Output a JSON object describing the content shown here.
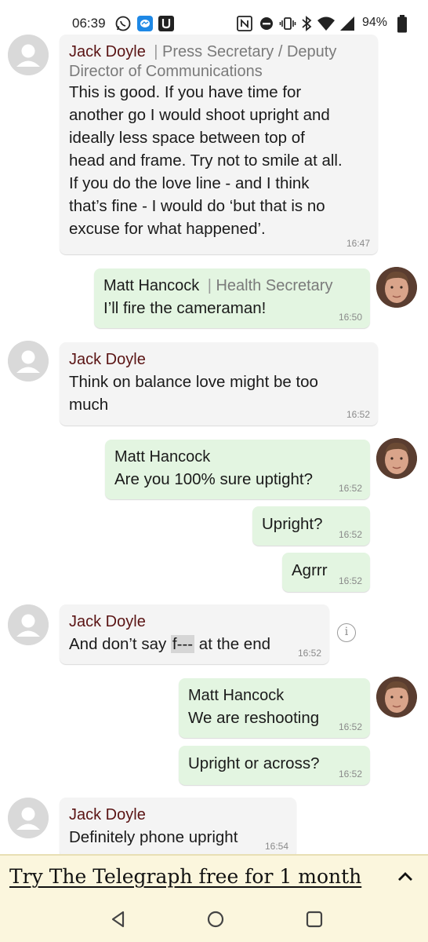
{
  "status_bar": {
    "time": "06:39",
    "battery": "94%",
    "icons": [
      "whatsapp-icon",
      "messenger-icon",
      "app-u-icon",
      "nfc-icon",
      "do-not-disturb-icon",
      "vibrate-icon",
      "bluetooth-icon",
      "wifi-icon",
      "signal-icon",
      "battery-icon"
    ]
  },
  "messages": [
    {
      "sender": "Jack Doyle",
      "role": "Press Secretary / Deputy Director of Communications",
      "role_sep": "|",
      "text_lines": [
        "This is good. If you have time for",
        "another go I would shoot upright and",
        "ideally less space between top of",
        "head and frame. Try not to smile at all.",
        "If you do the love line - and I think",
        "that’s fine - I would do ‘but that is no",
        "excuse for what happened’."
      ],
      "time": "16:47"
    },
    {
      "sender": "Matt Hancock",
      "role": "Health Secretary",
      "role_sep": "|",
      "text": "I’ll fire the cameraman!",
      "time": "16:50"
    },
    {
      "sender": "Jack Doyle",
      "text_lines": [
        "Think on balance love might be too",
        "much"
      ],
      "time": "16:52"
    },
    {
      "sender": "Matt Hancock",
      "text": "Are you 100% sure uptight?",
      "time": "16:52"
    },
    {
      "text": "Upright?",
      "time": "16:52"
    },
    {
      "text": "Agrrr",
      "time": "16:52"
    },
    {
      "sender": "Jack Doyle",
      "text_before": "And don’t say ",
      "text_redacted": "f---",
      "text_after": " at the end",
      "time": "16:52"
    },
    {
      "sender": "Matt Hancock",
      "text": "We are reshooting",
      "time": "16:52"
    },
    {
      "text": "Upright or across?",
      "time": "16:52"
    },
    {
      "sender": "Jack Doyle",
      "text": "Definitely phone upright",
      "time": "16:54"
    }
  ],
  "banner": {
    "text": "Try The Telegraph free for 1 month"
  },
  "colors": {
    "incoming_bubble": "#f4f4f4",
    "outgoing_bubble": "#e3f5e1",
    "jack_name": "#5a1414",
    "banner_bg": "#fbf6dd"
  },
  "nav": {
    "icons": [
      "back-icon",
      "home-icon",
      "recents-icon"
    ]
  }
}
